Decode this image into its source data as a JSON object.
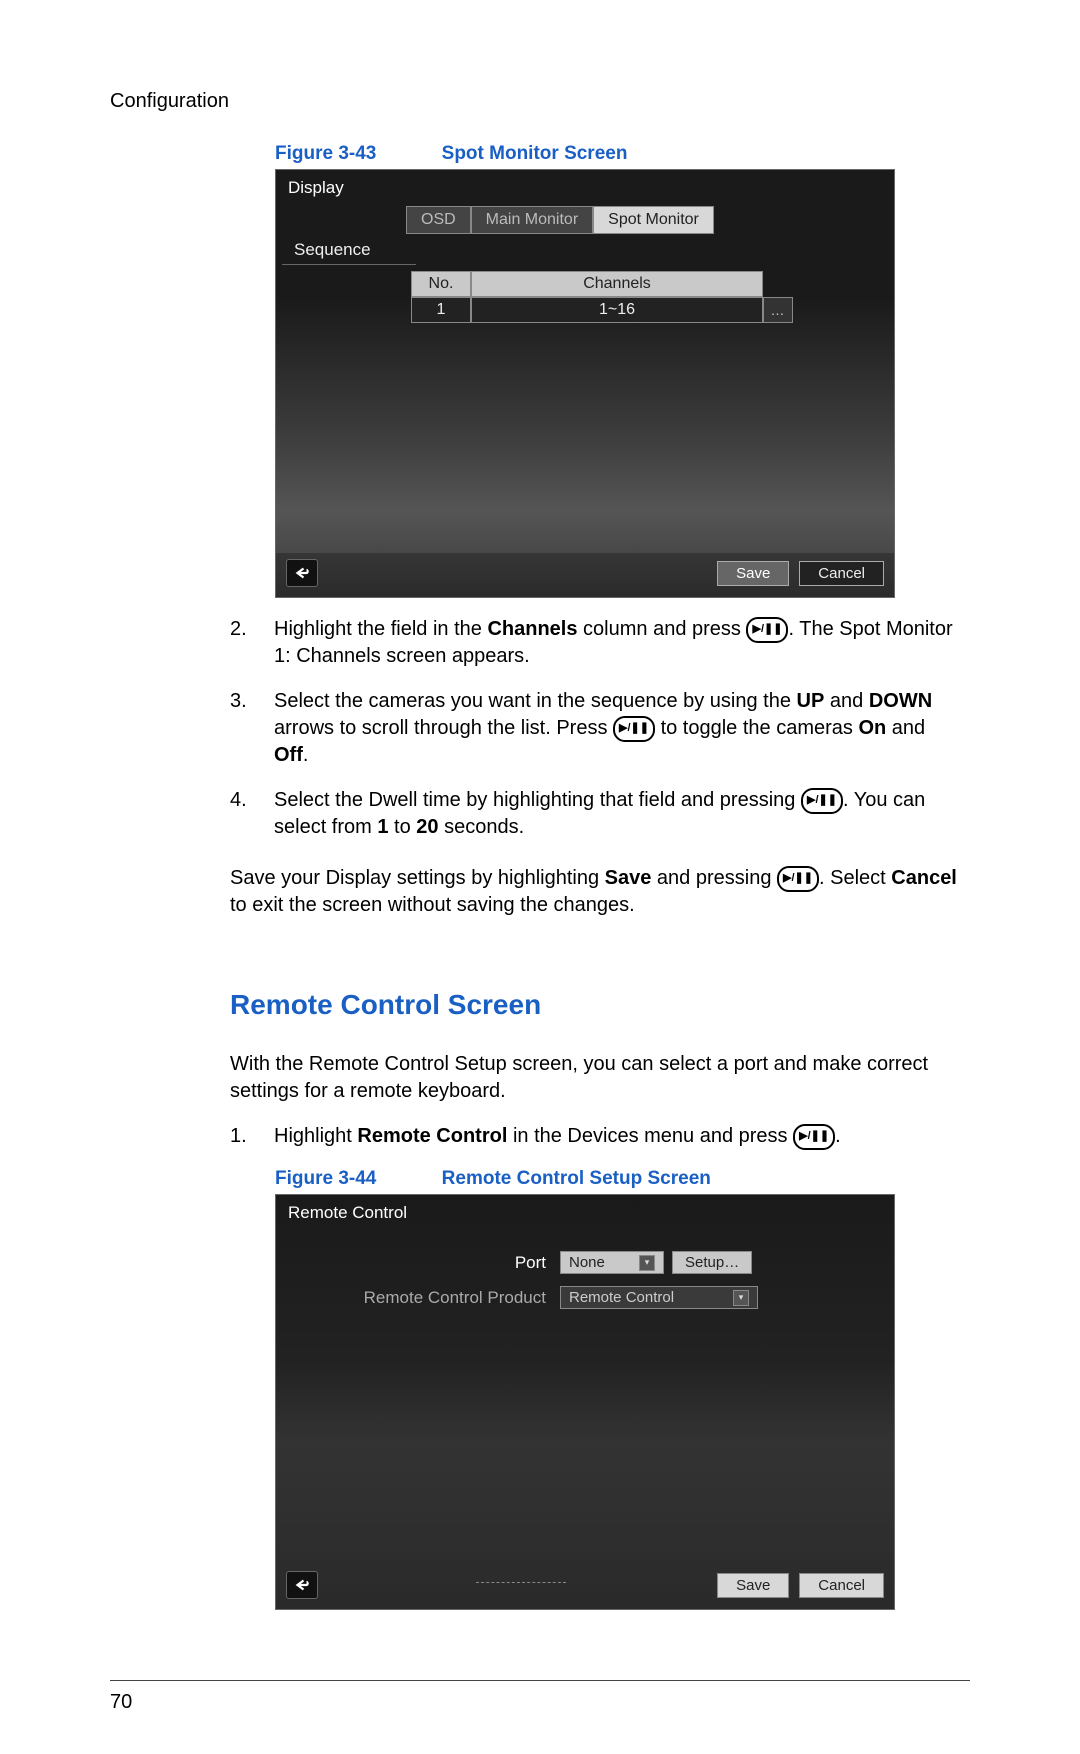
{
  "header_section": "Configuration",
  "figure43": {
    "label": "Figure 3-43",
    "title": "Spot Monitor Screen",
    "panel_title": "Display",
    "tabs": [
      "OSD",
      "Main Monitor",
      "Spot Monitor"
    ],
    "active_tab_index": 2,
    "sequence_label": "Sequence",
    "table": {
      "headers": [
        "No.",
        "Channels"
      ],
      "row": [
        "1",
        "1~16"
      ]
    },
    "save": "Save",
    "cancel": "Cancel"
  },
  "instructions": {
    "item2_a": "Highlight the field in the ",
    "item2_b": "Channels",
    "item2_c": " column and press ",
    "item2_d": ". The Spot Monitor 1: Channels screen appears.",
    "item3_a": "Select the cameras you want in the sequence by using the ",
    "item3_b": "UP",
    "item3_c": " and ",
    "item3_d": "DOWN",
    "item3_e": " arrows to scroll through the list. Press ",
    "item3_f": " to toggle the cameras ",
    "item3_g": "On",
    "item3_h": " and ",
    "item3_i": "Off",
    "item3_j": ".",
    "item4_a": "Select the Dwell time by highlighting that field and pressing ",
    "item4_b": ". You can select from ",
    "item4_c": "1",
    "item4_d": " to ",
    "item4_e": "20",
    "item4_f": " seconds.",
    "save_para_a": "Save your Display settings by highlighting ",
    "save_para_b": "Save",
    "save_para_c": " and pressing ",
    "save_para_d": ". Select ",
    "save_para_e": "Cancel",
    "save_para_f": " to exit the screen without saving the changes."
  },
  "section_heading": "Remote Control Screen",
  "remote_intro": "With the Remote Control Setup screen, you can select a port and make correct settings for a remote keyboard.",
  "remote_step1_a": "Highlight ",
  "remote_step1_b": "Remote Control",
  "remote_step1_c": " in the Devices menu and press ",
  "remote_step1_d": ".",
  "figure44": {
    "label": "Figure 3-44",
    "title": "Remote Control Setup Screen",
    "panel_title": "Remote Control",
    "port_label": "Port",
    "port_value": "None",
    "setup_btn": "Setup…",
    "product_label": "Remote Control Product",
    "product_value": "Remote Control",
    "save": "Save",
    "cancel": "Cancel"
  },
  "page_number": "70"
}
